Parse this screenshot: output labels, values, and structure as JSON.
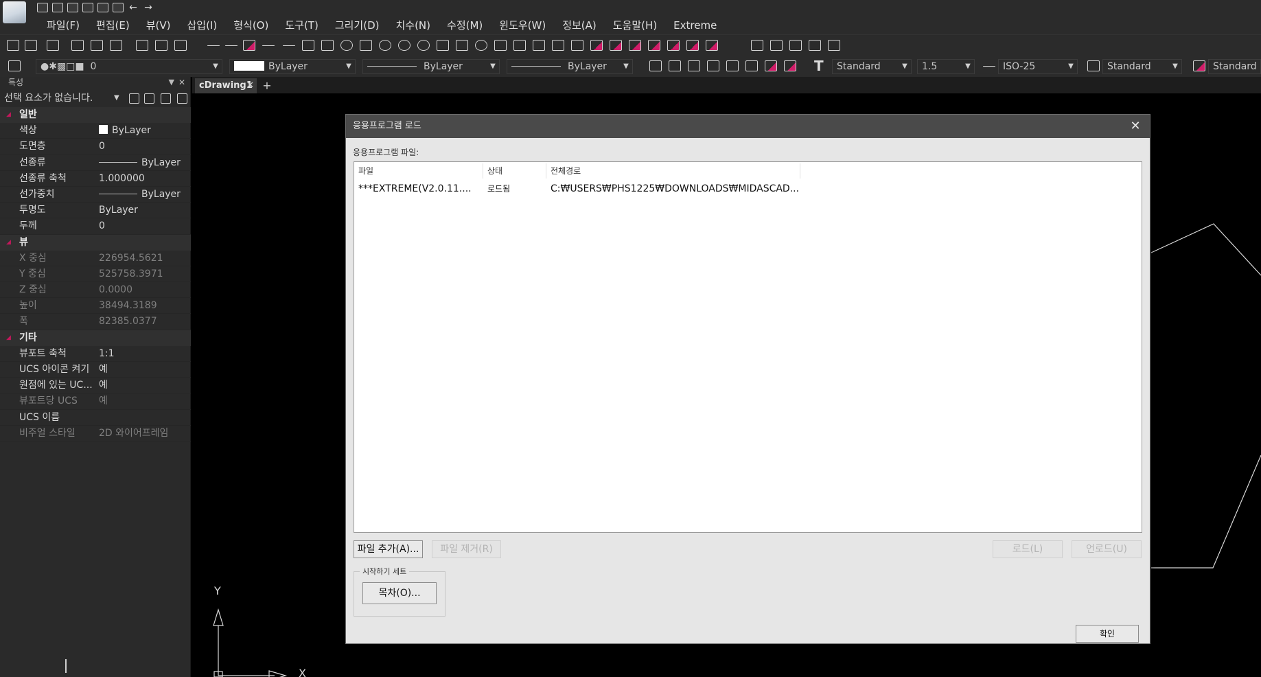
{
  "menu": {
    "items": [
      "파일(F)",
      "편집(E)",
      "뷰(V)",
      "삽입(I)",
      "형식(O)",
      "도구(T)",
      "그리기(D)",
      "치수(N)",
      "수정(M)",
      "윈도우(W)",
      "정보(A)",
      "도움말(H)",
      "Extreme"
    ]
  },
  "toolbar": {
    "layer_value": "0",
    "color_value": "ByLayer",
    "linetype_value": "ByLayer",
    "lineweight_value": "ByLayer",
    "text_style": "Standard",
    "text_height": "1.5",
    "dim_style": "ISO-25",
    "table_style": "Standard",
    "multileader_style": "Standard"
  },
  "panel": {
    "title": "특성",
    "selection": "선택 요소가 없습니다.",
    "sections": {
      "general": "일반",
      "view": "뷰",
      "misc": "기타"
    },
    "general": [
      {
        "k": "색상",
        "v": "ByLayer"
      },
      {
        "k": "도면층",
        "v": "0"
      },
      {
        "k": "선종류",
        "v": "ByLayer"
      },
      {
        "k": "선종류 축척",
        "v": "1.000000"
      },
      {
        "k": "선가중치",
        "v": "ByLayer"
      },
      {
        "k": "투명도",
        "v": "ByLayer"
      },
      {
        "k": "두께",
        "v": "0"
      }
    ],
    "view": [
      {
        "k": "X 중심",
        "v": "226954.5621"
      },
      {
        "k": "Y 중심",
        "v": "525758.3971"
      },
      {
        "k": "Z 중심",
        "v": "0.0000"
      },
      {
        "k": "높이",
        "v": "38494.3189"
      },
      {
        "k": "폭",
        "v": "82385.0377"
      }
    ],
    "misc": [
      {
        "k": "뷰포트 축척",
        "v": "1:1"
      },
      {
        "k": "UCS 아이콘 켜기",
        "v": "예"
      },
      {
        "k": "원점에 있는 UC...",
        "v": "예"
      },
      {
        "k": "뷰포트당 UCS",
        "v": "예"
      },
      {
        "k": "UCS 이름",
        "v": ""
      },
      {
        "k": "비주얼 스타일",
        "v": "2D 와이어프레임"
      }
    ]
  },
  "document": {
    "tab_name": "cDrawing1",
    "axis_y": "Y",
    "axis_x": "X"
  },
  "dialog": {
    "title": "응용프로그램 로드",
    "list_label": "응용프로그램 파일:",
    "columns": [
      "파일",
      "상태",
      "전체경로"
    ],
    "rows": [
      {
        "file": "***EXTREME(V2.0.11....",
        "status": "로드됨",
        "path": "C:₩USERS₩PHS1225₩DOWNLOADS₩MIDASCAD..."
      }
    ],
    "buttons": {
      "add_file": "파일 추가(A)...",
      "remove_file": "파일 제거(R)",
      "load": "로드(L)",
      "unload": "언로드(U)",
      "contents": "목차(O)...",
      "ok": "확인"
    },
    "startup_group": "시작하기 세트"
  },
  "colors": {
    "accent": "#d01c68",
    "background": "#000000",
    "chrome": "#2b2b2b",
    "dialog_bg": "#e6e6e6"
  }
}
